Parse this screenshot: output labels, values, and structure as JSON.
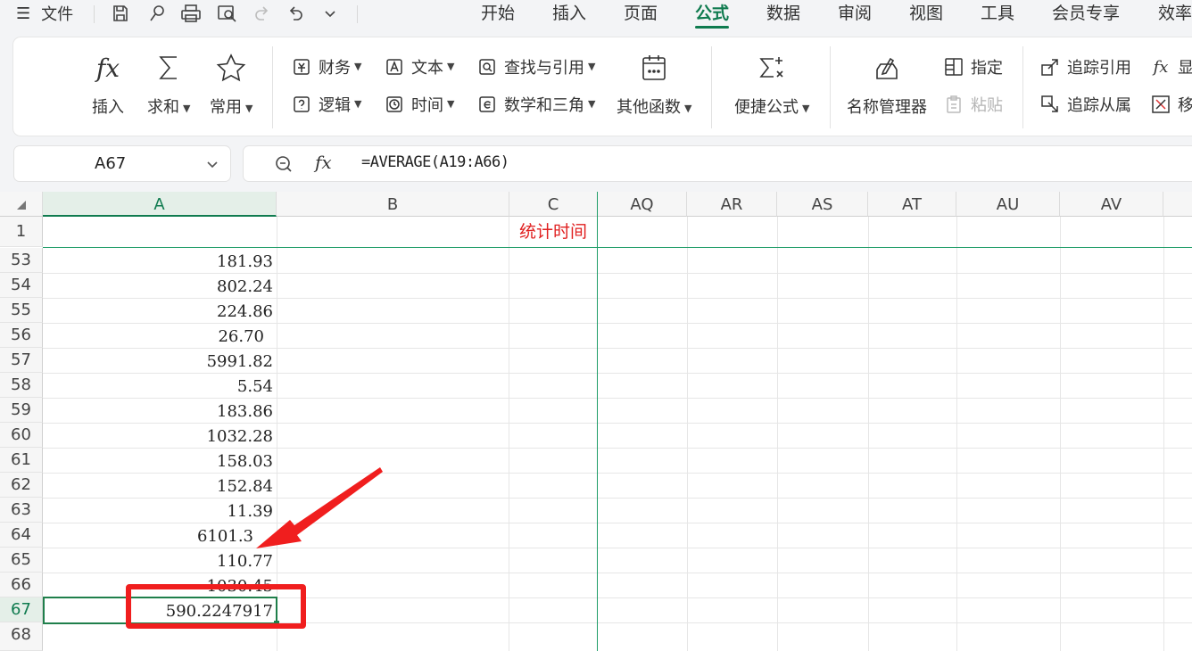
{
  "menu": {
    "file_label": "文件",
    "tabs": [
      {
        "label": "开始"
      },
      {
        "label": "插入"
      },
      {
        "label": "页面"
      },
      {
        "label": "公式"
      },
      {
        "label": "数据"
      },
      {
        "label": "审阅"
      },
      {
        "label": "视图"
      },
      {
        "label": "工具"
      },
      {
        "label": "会员专享"
      },
      {
        "label": "效率"
      }
    ],
    "active_tab": "公式"
  },
  "ribbon": {
    "insert_fn": "插入",
    "sum": "求和",
    "common": "常用",
    "finance": "财务",
    "text": "文本",
    "lookup": "查找与引用",
    "logic": "逻辑",
    "time": "时间",
    "math": "数学和三角",
    "other_fn": "其他函数",
    "quick_formula": "便捷公式",
    "name_manager": "名称管理器",
    "assign": "指定",
    "paste": "粘贴",
    "trace_precedents": "追踪引用",
    "trace_dependents": "追踪从属",
    "show_formula": "显",
    "remove": "移"
  },
  "namebox": {
    "value": "A67"
  },
  "formula_bar": {
    "fx_symbol": "fx",
    "formula": "=AVERAGE(A19:A66)"
  },
  "grid": {
    "columns": [
      "A",
      "B",
      "C",
      "AQ",
      "AR",
      "AS",
      "AT",
      "AU",
      "AV"
    ],
    "selected_column": "A",
    "header_row": {
      "row": "1",
      "c_text": "统计时间"
    },
    "rows": [
      {
        "row": "53",
        "a": "181.93"
      },
      {
        "row": "54",
        "a": "802.24"
      },
      {
        "row": "55",
        "a": "224.86"
      },
      {
        "row": "56",
        "a": "26.70 "
      },
      {
        "row": "57",
        "a": "5991.82"
      },
      {
        "row": "58",
        "a": "5.54"
      },
      {
        "row": "59",
        "a": "183.86"
      },
      {
        "row": "60",
        "a": "1032.28"
      },
      {
        "row": "61",
        "a": "158.03"
      },
      {
        "row": "62",
        "a": "152.84"
      },
      {
        "row": "63",
        "a": "11.39"
      },
      {
        "row": "64",
        "a": "6101.3"
      },
      {
        "row": "65",
        "a": "110.77"
      },
      {
        "row": "66",
        "a": "1030.45"
      },
      {
        "row": "67",
        "a": "590.2247917"
      },
      {
        "row": "68",
        "a": ""
      }
    ],
    "active_row": "67"
  },
  "annotation_colors": {
    "arrow": "#f01e1e",
    "box": "#f01e1e"
  }
}
